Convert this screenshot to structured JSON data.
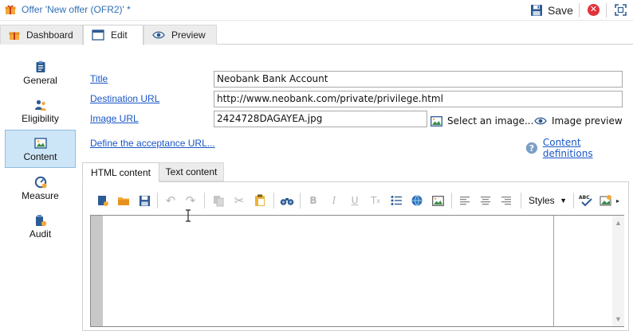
{
  "window": {
    "title": "Offer 'New offer (OFR2)' *",
    "save_label": "Save"
  },
  "tabs": [
    {
      "label": "Dashboard",
      "icon": "gift-icon"
    },
    {
      "label": "Edit",
      "icon": "form-icon",
      "active": true
    },
    {
      "label": "Preview",
      "icon": "eye-icon"
    }
  ],
  "sidebar": {
    "items": [
      {
        "label": "General",
        "icon": "clipboard-icon"
      },
      {
        "label": "Eligibility",
        "icon": "users-icon"
      },
      {
        "label": "Content",
        "icon": "image-icon",
        "selected": true
      },
      {
        "label": "Measure",
        "icon": "gauge-icon"
      },
      {
        "label": "Audit",
        "icon": "audit-icon"
      }
    ]
  },
  "form": {
    "title_label": "Title",
    "title_value": "Neobank Bank Account",
    "destination_label": "Destination URL",
    "destination_value": "http://www.neobank.com/private/privilege.html",
    "image_label": "Image URL",
    "image_value": "2424728DAGAYEA.jpg",
    "select_image_label": "Select an image...",
    "image_preview_label": "Image preview",
    "acceptance_link": "Define the acceptance URL...",
    "content_definitions_link": "Content definitions"
  },
  "content_tabs": [
    {
      "label": "HTML content",
      "active": true
    },
    {
      "label": "Text content"
    }
  ],
  "editor": {
    "styles_label": "Styles",
    "spell_label": "ABC"
  },
  "colors": {
    "accent_blue": "#1a56c7",
    "title_blue": "#2f6fb7",
    "selected_bg": "#cde6f7",
    "close_red": "#e0333b"
  }
}
